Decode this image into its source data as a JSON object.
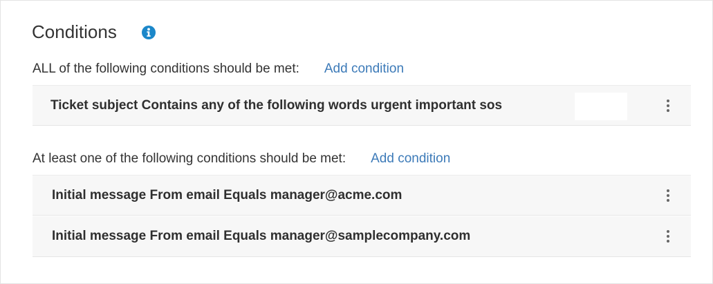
{
  "section": {
    "title": "Conditions",
    "info_icon": "info-icon",
    "accent": "#1b87c9"
  },
  "all_group": {
    "label": "ALL of the following conditions should be met:",
    "add_label": "Add condition",
    "conditions": [
      "Ticket subject Contains any of the following words urgent important sos"
    ]
  },
  "any_group": {
    "label": "At least one of the following conditions should be met:",
    "add_label": "Add condition",
    "conditions": [
      "Initial message From email Equals manager@acme.com",
      "Initial message From email Equals manager@samplecompany.com"
    ]
  },
  "colors": {
    "link": "#3c7ab8",
    "row_bg": "#f7f7f7",
    "text": "#333333"
  }
}
